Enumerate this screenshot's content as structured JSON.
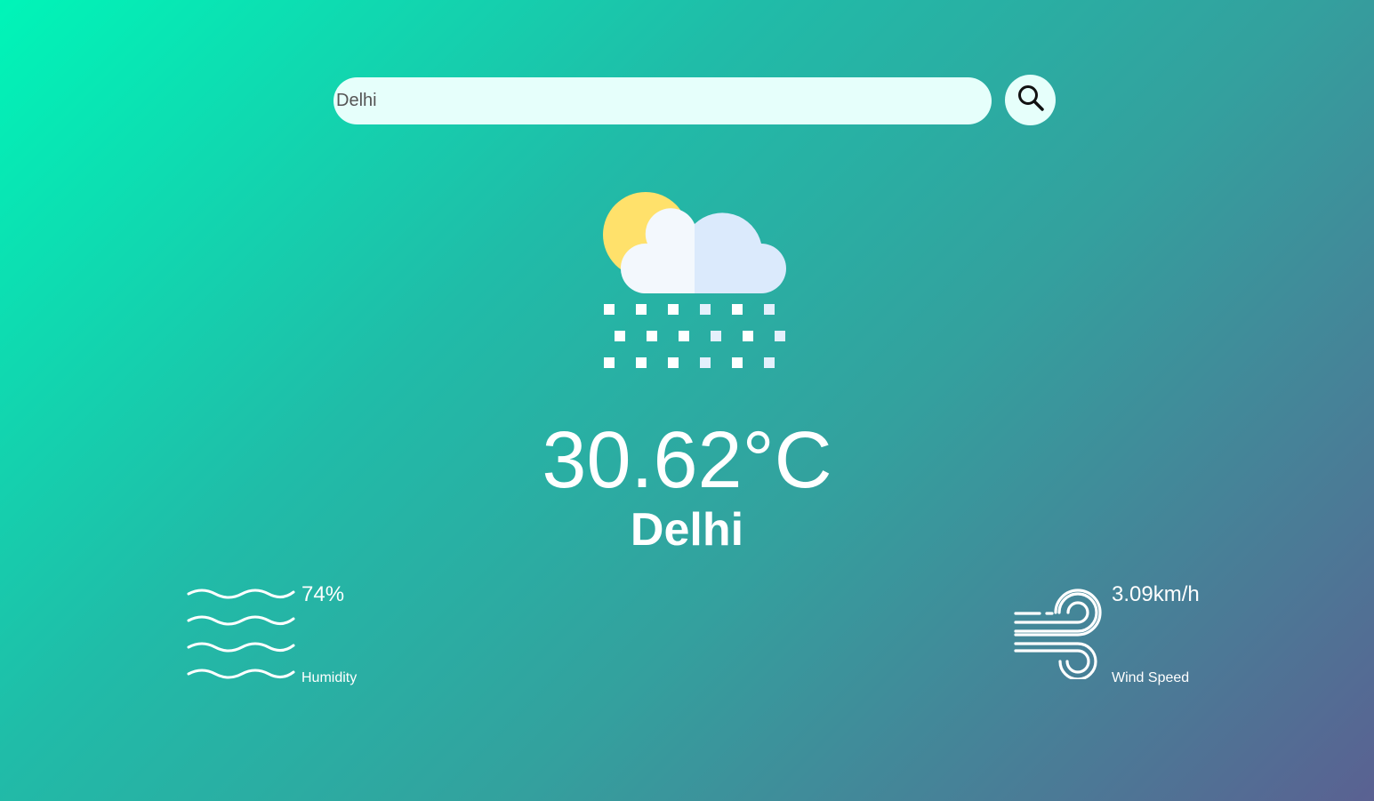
{
  "search": {
    "value": "Delhi",
    "icon": "search-icon"
  },
  "weather": {
    "icon": "sun-cloud-snow-icon",
    "temperature": "30.62°C",
    "city": "Delhi"
  },
  "humidity": {
    "icon": "water-waves-icon",
    "value": "74%",
    "label": "Humidity"
  },
  "wind": {
    "icon": "wind-icon",
    "value": "3.09km/h",
    "label": "Wind Speed"
  },
  "colors": {
    "gradient_start": "#00f5b8",
    "gradient_end": "#5a6192",
    "search_bg": "#e6fffb",
    "sun": "#ffe16b",
    "cloud_light": "#f3f8fd",
    "cloud_shade": "#dbeafc"
  }
}
